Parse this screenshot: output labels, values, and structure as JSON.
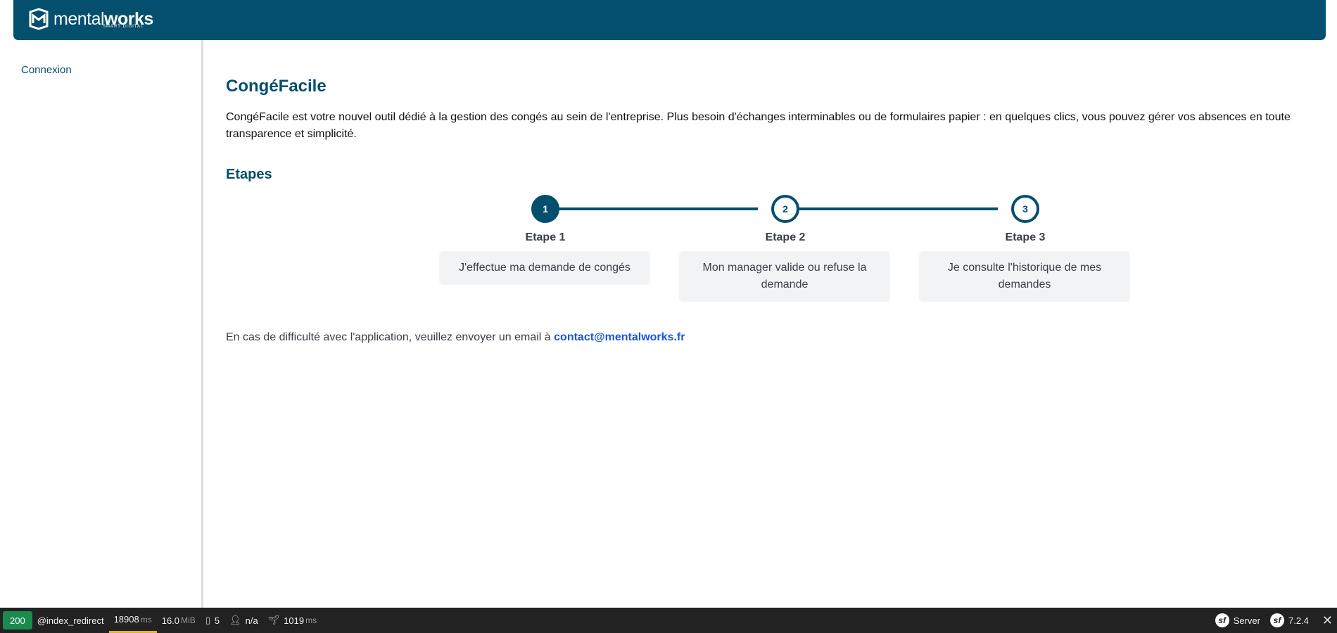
{
  "brand": {
    "name_light": "mental",
    "name_bold": "works",
    "tagline": "SMART DIGITAL",
    "color": "#034f6d"
  },
  "sidebar": {
    "items": [
      {
        "label": "Connexion"
      }
    ]
  },
  "main": {
    "title": "CongéFacile",
    "intro": "CongéFacile est votre nouvel outil dédié à la gestion des congés au sein de l'entreprise. Plus besoin d'échanges interminables ou de formulaires papier : en quelques clics, vous pouvez gérer vos absences en toute transparence et simplicité.",
    "steps_title": "Etapes",
    "steps": [
      {
        "number": "1",
        "label": "Etape 1",
        "description": "J'effectue ma demande de congés",
        "active": true
      },
      {
        "number": "2",
        "label": "Etape 2",
        "description": "Mon manager valide ou refuse la demande",
        "active": false
      },
      {
        "number": "3",
        "label": "Etape 3",
        "description": "Je consulte l'historique de mes demandes",
        "active": false
      }
    ],
    "contact_text": "En cas de difficulté avec l'application, veuillez envoyer un email à ",
    "contact_email": "contact@mentalworks.fr"
  },
  "debug_toolbar": {
    "status_code": "200",
    "route": "@index_redirect",
    "time_value": "18908",
    "time_unit": "ms",
    "memory_value": "16.0",
    "memory_unit": "MiB",
    "logs_count": "5",
    "user": "n/a",
    "twig_time_value": "1019",
    "twig_time_unit": "ms",
    "server_label": "Server",
    "symfony_version": "7.2.4"
  }
}
